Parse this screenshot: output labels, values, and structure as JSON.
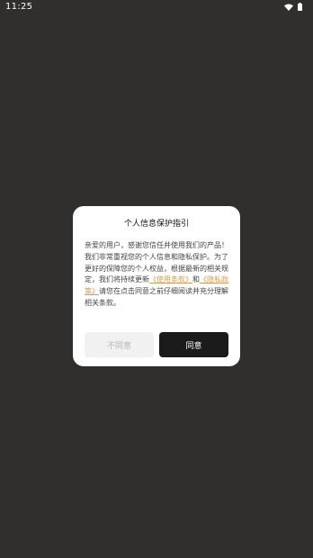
{
  "status_bar": {
    "time": "11:25",
    "icons": [
      "wifi-icon",
      "battery-icon"
    ]
  },
  "dialog": {
    "title": "个人信息保护指引",
    "body_before": "亲爱的用户，感谢您信任并使用我们的产品！我们非常重视您的个人信息和隐私保护。为了更好的保障您的个人权益，根据最新的相关规定，我们将持续更新",
    "terms_link": "《使用条款》",
    "and_text": "和",
    "privacy_link": "《隐私政策》",
    "body_after": "请您在点击同意之前仔细阅读并充分理解相关条款。",
    "disagree_label": "不同意",
    "agree_label": "同意"
  },
  "colors": {
    "background": "#312f2e",
    "link": "#c8a05a",
    "agree_button": "#1b1b1b",
    "disagree_button": "#f1f1f1"
  }
}
